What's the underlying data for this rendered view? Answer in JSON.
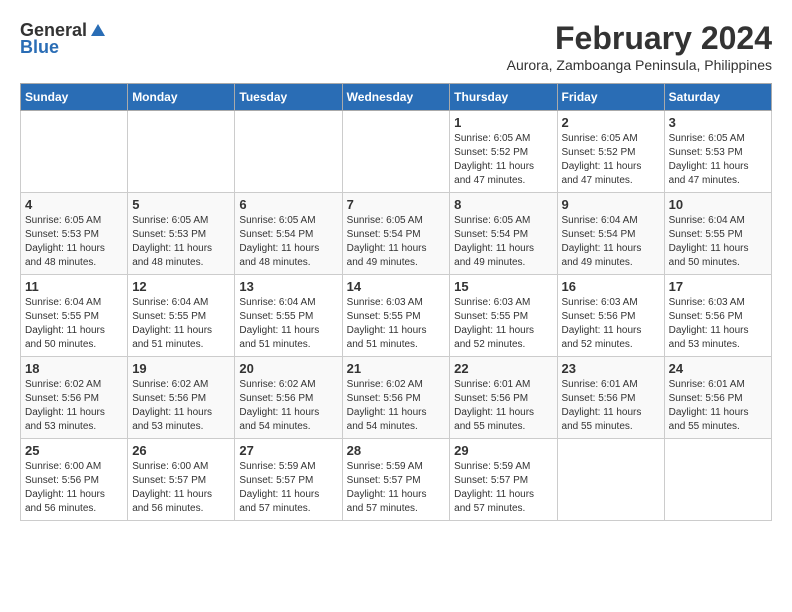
{
  "logo": {
    "general": "General",
    "blue": "Blue"
  },
  "title": {
    "month_year": "February 2024",
    "location": "Aurora, Zamboanga Peninsula, Philippines"
  },
  "calendar": {
    "headers": [
      "Sunday",
      "Monday",
      "Tuesday",
      "Wednesday",
      "Thursday",
      "Friday",
      "Saturday"
    ],
    "weeks": [
      [
        {
          "day": "",
          "info": ""
        },
        {
          "day": "",
          "info": ""
        },
        {
          "day": "",
          "info": ""
        },
        {
          "day": "",
          "info": ""
        },
        {
          "day": "1",
          "info": "Sunrise: 6:05 AM\nSunset: 5:52 PM\nDaylight: 11 hours and 47 minutes."
        },
        {
          "day": "2",
          "info": "Sunrise: 6:05 AM\nSunset: 5:52 PM\nDaylight: 11 hours and 47 minutes."
        },
        {
          "day": "3",
          "info": "Sunrise: 6:05 AM\nSunset: 5:53 PM\nDaylight: 11 hours and 47 minutes."
        }
      ],
      [
        {
          "day": "4",
          "info": "Sunrise: 6:05 AM\nSunset: 5:53 PM\nDaylight: 11 hours and 48 minutes."
        },
        {
          "day": "5",
          "info": "Sunrise: 6:05 AM\nSunset: 5:53 PM\nDaylight: 11 hours and 48 minutes."
        },
        {
          "day": "6",
          "info": "Sunrise: 6:05 AM\nSunset: 5:54 PM\nDaylight: 11 hours and 48 minutes."
        },
        {
          "day": "7",
          "info": "Sunrise: 6:05 AM\nSunset: 5:54 PM\nDaylight: 11 hours and 49 minutes."
        },
        {
          "day": "8",
          "info": "Sunrise: 6:05 AM\nSunset: 5:54 PM\nDaylight: 11 hours and 49 minutes."
        },
        {
          "day": "9",
          "info": "Sunrise: 6:04 AM\nSunset: 5:54 PM\nDaylight: 11 hours and 49 minutes."
        },
        {
          "day": "10",
          "info": "Sunrise: 6:04 AM\nSunset: 5:55 PM\nDaylight: 11 hours and 50 minutes."
        }
      ],
      [
        {
          "day": "11",
          "info": "Sunrise: 6:04 AM\nSunset: 5:55 PM\nDaylight: 11 hours and 50 minutes."
        },
        {
          "day": "12",
          "info": "Sunrise: 6:04 AM\nSunset: 5:55 PM\nDaylight: 11 hours and 51 minutes."
        },
        {
          "day": "13",
          "info": "Sunrise: 6:04 AM\nSunset: 5:55 PM\nDaylight: 11 hours and 51 minutes."
        },
        {
          "day": "14",
          "info": "Sunrise: 6:03 AM\nSunset: 5:55 PM\nDaylight: 11 hours and 51 minutes."
        },
        {
          "day": "15",
          "info": "Sunrise: 6:03 AM\nSunset: 5:55 PM\nDaylight: 11 hours and 52 minutes."
        },
        {
          "day": "16",
          "info": "Sunrise: 6:03 AM\nSunset: 5:56 PM\nDaylight: 11 hours and 52 minutes."
        },
        {
          "day": "17",
          "info": "Sunrise: 6:03 AM\nSunset: 5:56 PM\nDaylight: 11 hours and 53 minutes."
        }
      ],
      [
        {
          "day": "18",
          "info": "Sunrise: 6:02 AM\nSunset: 5:56 PM\nDaylight: 11 hours and 53 minutes."
        },
        {
          "day": "19",
          "info": "Sunrise: 6:02 AM\nSunset: 5:56 PM\nDaylight: 11 hours and 53 minutes."
        },
        {
          "day": "20",
          "info": "Sunrise: 6:02 AM\nSunset: 5:56 PM\nDaylight: 11 hours and 54 minutes."
        },
        {
          "day": "21",
          "info": "Sunrise: 6:02 AM\nSunset: 5:56 PM\nDaylight: 11 hours and 54 minutes."
        },
        {
          "day": "22",
          "info": "Sunrise: 6:01 AM\nSunset: 5:56 PM\nDaylight: 11 hours and 55 minutes."
        },
        {
          "day": "23",
          "info": "Sunrise: 6:01 AM\nSunset: 5:56 PM\nDaylight: 11 hours and 55 minutes."
        },
        {
          "day": "24",
          "info": "Sunrise: 6:01 AM\nSunset: 5:56 PM\nDaylight: 11 hours and 55 minutes."
        }
      ],
      [
        {
          "day": "25",
          "info": "Sunrise: 6:00 AM\nSunset: 5:56 PM\nDaylight: 11 hours and 56 minutes."
        },
        {
          "day": "26",
          "info": "Sunrise: 6:00 AM\nSunset: 5:57 PM\nDaylight: 11 hours and 56 minutes."
        },
        {
          "day": "27",
          "info": "Sunrise: 5:59 AM\nSunset: 5:57 PM\nDaylight: 11 hours and 57 minutes."
        },
        {
          "day": "28",
          "info": "Sunrise: 5:59 AM\nSunset: 5:57 PM\nDaylight: 11 hours and 57 minutes."
        },
        {
          "day": "29",
          "info": "Sunrise: 5:59 AM\nSunset: 5:57 PM\nDaylight: 11 hours and 57 minutes."
        },
        {
          "day": "",
          "info": ""
        },
        {
          "day": "",
          "info": ""
        }
      ]
    ]
  }
}
